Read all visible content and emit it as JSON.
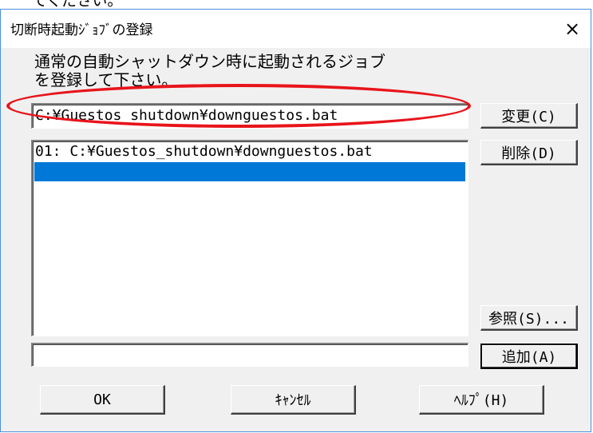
{
  "top_fragment": "てください。",
  "dialog": {
    "title": "切断時起動ｼﾞｮﾌﾞの登録",
    "close_label": "×",
    "instruction_line1": "通常の自動シャットダウン時に起動されるジョブ",
    "instruction_line2": "を登録して下さい。"
  },
  "job_path_input": {
    "value": "C:¥Guestos_shutdown¥downguestos.bat"
  },
  "job_list": {
    "items": [
      {
        "label": "01: C:¥Guestos_shutdown¥downguestos.bat",
        "selected": false
      },
      {
        "label": "",
        "selected": true
      }
    ]
  },
  "add_input": {
    "value": ""
  },
  "buttons": {
    "change": "変更(C)",
    "delete": "削除(D)",
    "browse": "参照(S)...",
    "add": "追加(A)",
    "ok": "OK",
    "cancel": "ｷｬﾝｾﾙ",
    "help": "ﾍﾙﾌﾟ(H)"
  },
  "colors": {
    "highlight_ellipse": "#e8141b",
    "selection": "#0078d7",
    "window_border": "#4a90d9"
  }
}
